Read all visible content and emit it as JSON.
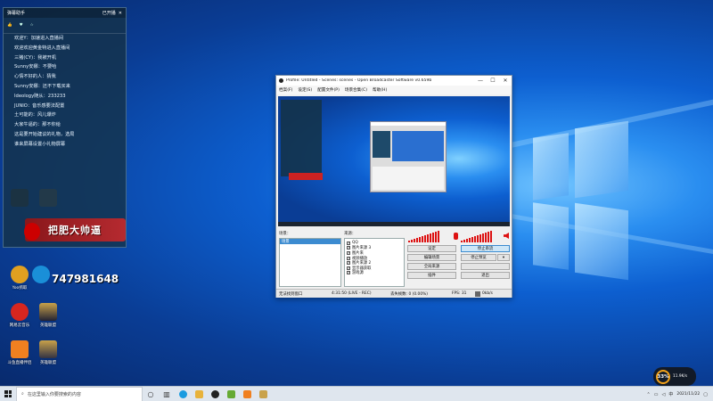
{
  "chat": {
    "room_name": "弹幕助手",
    "close_label": "已开播",
    "stats": [
      "",
      "",
      ""
    ],
    "messages": [
      "欢迎Y：加速进入直播间",
      "欢迎欢迎黄金特进入直播间",
      "三猪(CY)：我被开机",
      "Sunny安娜：不要哈",
      "心情不好的人：猜我",
      "Sunny安娜：还不下载买来",
      "Ideology随从：233233",
      "JUNIO：音乐感要法配置",
      "土可能的：风儿爆炸",
      "大家牛逼的：那不你给",
      "这是要开始建议的礼物，选局",
      "谁来屏幕设置小礼物屏幕"
    ],
    "banner_text": "把肥大帅逼",
    "qq_number": "747981648"
  },
  "desktop_icons": [
    {
      "label": "",
      "color": "#333"
    },
    {
      "label": "",
      "color": "#444"
    },
    {
      "label": "",
      "color": "#c33"
    },
    {
      "label": "",
      "color": "#555"
    },
    {
      "label": "",
      "color": "#d03"
    },
    {
      "label": "Yoo抓取",
      "color": "#e0a020"
    },
    {
      "label": "",
      "color": "#1a8fd8"
    },
    {
      "label": "网易云音乐",
      "color": "#d7261f"
    },
    {
      "label": "英雄联盟",
      "color": "#223"
    },
    {
      "label": "斗鱼直播伴侣",
      "color": "#f08020"
    },
    {
      "label": "英雄联盟",
      "color": "#334"
    }
  ],
  "obs": {
    "title": "Profile: Untitled - Scenes: scenes - Open Broadcaster Software v0.659b",
    "menu": [
      "档案(F)",
      "设定(S)",
      "配置文件(P)",
      "场景合集(C)",
      "帮助(H)"
    ],
    "scenes_label": "场景：",
    "sources_label": "来源：",
    "scenes": [
      "场景"
    ],
    "sources": [
      "QQ",
      "图片来源 3",
      "图片来",
      "视频播放",
      "图片来源 2",
      "显示器获取",
      "游戏源"
    ],
    "buttons": {
      "settings": "设定",
      "stop_stream": "停止串流",
      "edit_scene": "编辑场景",
      "stop_preview": "停止预览",
      "global_sources": "全局来源",
      "plugins": "插件",
      "exit": "退出"
    },
    "status": {
      "window": "无法找到窗口",
      "time": "4:31:50 (LIVE - REC)",
      "dropped": "丢失帧数: 0 (0.00%)",
      "fps": "FPS: 31",
      "bitrate": "0kb/s"
    }
  },
  "taskbar": {
    "search_placeholder": "在这里输入你要搜索的内容",
    "clock_time": "",
    "clock_date": "2021/11/22"
  },
  "gauge": {
    "percent": "33%",
    "up": "",
    "down": "11.9K/s"
  },
  "colors": {
    "meter": "#d11",
    "accent": "#3c8bd0"
  }
}
